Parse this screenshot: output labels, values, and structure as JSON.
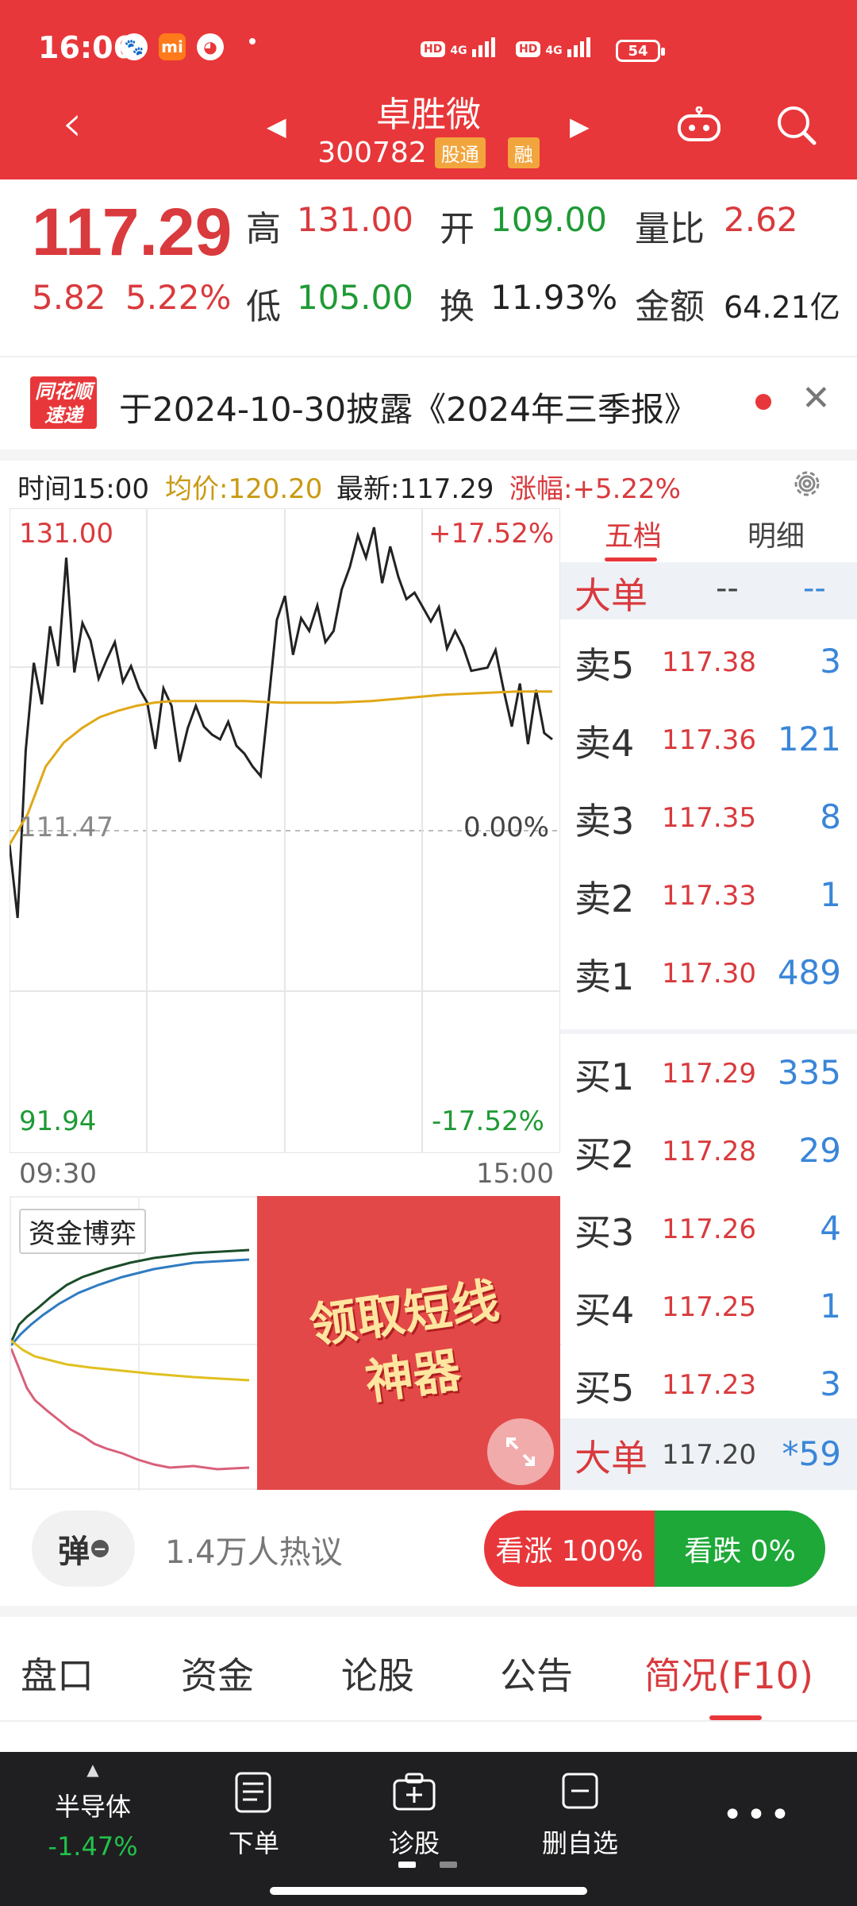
{
  "status_bar": {
    "time": "16:06",
    "battery": "54",
    "net_tag": "HD",
    "net_gen": "4G"
  },
  "header": {
    "stock_name": "卓胜微",
    "stock_code": "300782",
    "tags": [
      "股通",
      "融"
    ],
    "back_icon": "chevron-left-icon",
    "prev_icon": "triangle-left-icon",
    "next_icon": "triangle-right-icon",
    "assistant_icon": "robot-icon",
    "search_icon": "search-icon",
    "accent_color": "#e8373a"
  },
  "quote": {
    "price": "117.29",
    "change": "5.82",
    "change_pct": "5.22%",
    "high_label": "高",
    "high": "131.00",
    "open_label": "开",
    "open": "109.00",
    "vol_ratio_label": "量比",
    "vol_ratio": "2.62",
    "low_label": "低",
    "low": "105.00",
    "turnover_label": "换",
    "turnover": "11.93%",
    "amount_label": "金额",
    "amount": "64.21亿"
  },
  "notice": {
    "logo_line1": "同花顺",
    "logo_line2": "速递",
    "text": "于2024-10-30披露《2024年三季报》"
  },
  "chart_header": {
    "time": "时间15:00",
    "avg": "均价:120.20",
    "latest": "最新:117.29",
    "change": "涨幅:+5.22%"
  },
  "chart_labels": {
    "y_top": "131.00",
    "y_top_pct": "+17.52%",
    "y_mid": "111.47",
    "y_mid_pct": "0.00%",
    "y_bottom": "91.94",
    "y_bottom_pct": "-17.52%",
    "x_start": "09:30",
    "x_end": "15:00"
  },
  "chart_data": {
    "type": "line",
    "ylim": [
      91.94,
      131.0
    ],
    "reference": 111.47,
    "x_start": "09:30",
    "x_end": "15:00",
    "series": [
      {
        "name": "最新",
        "color": "#222222",
        "values": [
          110.6,
          106.0,
          116.5,
          122.0,
          119.4,
          124.3,
          121.8,
          128.6,
          121.4,
          124.5,
          123.4,
          121.0,
          122.2,
          123.3,
          120.8,
          121.8,
          120.4,
          119.5,
          116.6,
          120.4,
          119.3,
          115.8,
          117.9,
          119.3,
          118.0,
          117.5,
          117.2,
          118.3,
          116.8,
          116.3,
          115.5,
          114.9,
          119.7,
          124.7,
          126.2,
          122.5,
          124.8,
          124.0,
          125.6,
          123.3,
          124.0,
          126.6,
          128.0,
          130.0,
          128.6,
          130.5,
          127.0,
          129.3,
          127.4,
          126.0,
          126.4,
          125.5,
          124.6,
          125.5,
          122.9,
          124.0,
          123.0,
          121.5,
          121.6,
          121.7,
          122.8,
          120.3,
          118.0,
          120.7,
          116.9,
          120.3,
          117.6,
          117.2
        ]
      },
      {
        "name": "均价",
        "color": "#e0a818",
        "values": [
          110.6,
          112.5,
          115.5,
          117.0,
          117.9,
          118.6,
          119.0,
          119.3,
          119.5,
          119.6,
          119.6,
          119.6,
          119.6,
          119.6,
          119.55,
          119.5,
          119.5,
          119.5,
          119.5,
          119.55,
          119.6,
          119.7,
          119.8,
          119.9,
          120.0,
          120.05,
          120.1,
          120.15,
          120.2,
          120.2,
          120.2
        ]
      }
    ]
  },
  "order_book": {
    "tab_active": "五档",
    "tab_other": "明细",
    "big_label": "大单",
    "big_val1": "--",
    "big_val2": "--",
    "asks": [
      {
        "label": "卖5",
        "price": "117.38",
        "vol": "3"
      },
      {
        "label": "卖4",
        "price": "117.36",
        "vol": "121"
      },
      {
        "label": "卖3",
        "price": "117.35",
        "vol": "8"
      },
      {
        "label": "卖2",
        "price": "117.33",
        "vol": "1"
      },
      {
        "label": "卖1",
        "price": "117.30",
        "vol": "489"
      }
    ],
    "bids": [
      {
        "label": "买1",
        "price": "117.29",
        "vol": "335"
      },
      {
        "label": "买2",
        "price": "117.28",
        "vol": "29"
      },
      {
        "label": "买3",
        "price": "117.26",
        "vol": "4"
      },
      {
        "label": "买4",
        "price": "117.25",
        "vol": "1"
      },
      {
        "label": "买5",
        "price": "117.23",
        "vol": "3"
      }
    ],
    "big_trade_label": "大单",
    "big_trade_price": "117.20",
    "big_trade_vol": "*59"
  },
  "capital": {
    "title": "资金博弈",
    "promo_line1": "领取短线",
    "promo_line2": "神器"
  },
  "discussion": {
    "danmu": "弹",
    "text": "1.4万人热议",
    "up": "看涨 100%",
    "down": "看跌 0%"
  },
  "tabs": [
    "盘口",
    "资金",
    "论股",
    "公告",
    "简况(F10)"
  ],
  "bottom_bar": {
    "sector": "半导体",
    "sector_change": "-1.47%",
    "order": "下单",
    "diagnose": "诊股",
    "remove_fav": "删自选"
  }
}
